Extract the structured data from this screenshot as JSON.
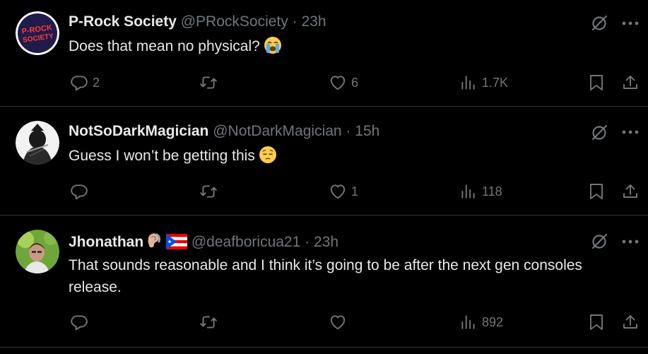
{
  "colors": {
    "background": "#000000",
    "text": "#e7e9ea",
    "secondary": "#71767b",
    "divider": "#2f3336"
  },
  "replies": [
    {
      "name": "P-Rock Society",
      "handle": "@PRockSociety",
      "separator": "·",
      "time": "23h",
      "text": "Does that mean no physical?",
      "emoji": "loudly-crying-face",
      "avatar_text_line1": "P-ROCK",
      "avatar_text_line2": "SOCIETY",
      "stats": {
        "replies": "2",
        "reposts": "",
        "likes": "6",
        "views": "1.7K"
      }
    },
    {
      "name": "NotSoDarkMagician",
      "handle": "@NotDarkMagician",
      "separator": "·",
      "time": "15h",
      "text": "Guess I won’t be getting this",
      "emoji": "pensive-face",
      "stats": {
        "replies": "",
        "reposts": "",
        "likes": "1",
        "views": "118"
      }
    },
    {
      "name": "Jhonathan",
      "name_icons": [
        "ear-with-hearing-aid-icon",
        "puerto-rico-flag-icon"
      ],
      "handle": "@deafboricua21",
      "separator": "·",
      "time": "23h",
      "text": "That sounds reasonable and I think it’s going to be after the next gen consoles release.",
      "stats": {
        "replies": "",
        "reposts": "",
        "likes": "",
        "views": "892"
      }
    }
  ]
}
